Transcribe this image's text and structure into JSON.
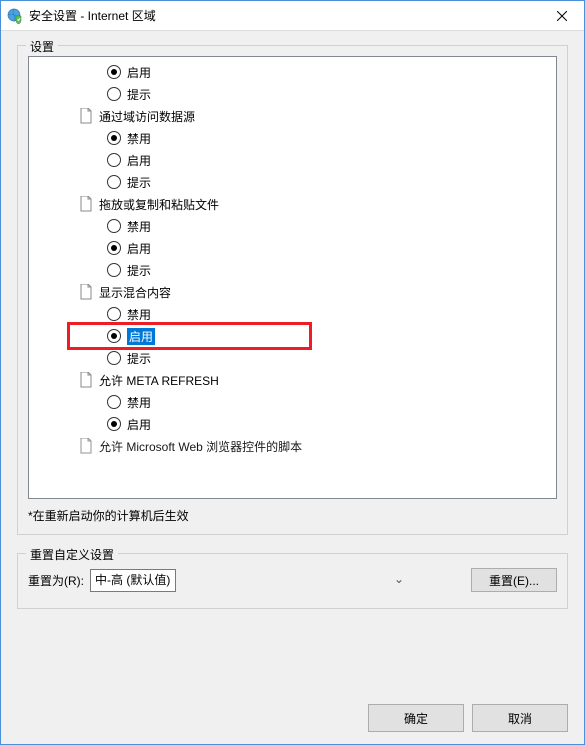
{
  "titlebar": {
    "title": "安全设置 - Internet 区域"
  },
  "settings": {
    "legend": "设置",
    "groups": [
      {
        "options": [
          {
            "label": "启用",
            "checked": true
          },
          {
            "label": "提示",
            "checked": false
          }
        ]
      },
      {
        "title": "通过域访问数据源",
        "options": [
          {
            "label": "禁用",
            "checked": true
          },
          {
            "label": "启用",
            "checked": false
          },
          {
            "label": "提示",
            "checked": false
          }
        ]
      },
      {
        "title": "拖放或复制和粘贴文件",
        "options": [
          {
            "label": "禁用",
            "checked": false
          },
          {
            "label": "启用",
            "checked": true
          },
          {
            "label": "提示",
            "checked": false
          }
        ]
      },
      {
        "title": "显示混合内容",
        "options": [
          {
            "label": "禁用",
            "checked": false
          },
          {
            "label": "启用",
            "checked": true,
            "selected": true,
            "highlighted": true
          },
          {
            "label": "提示",
            "checked": false
          }
        ]
      },
      {
        "title": "允许 META REFRESH",
        "options": [
          {
            "label": "禁用",
            "checked": false
          },
          {
            "label": "启用",
            "checked": true
          }
        ]
      },
      {
        "title_partial": "允许 Microsoft Web 浏览器控件的脚本"
      }
    ],
    "note": "*在重新启动你的计算机后生效"
  },
  "reset": {
    "legend": "重置自定义设置",
    "label": "重置为(R):",
    "selected": "中-高 (默认值)",
    "button": "重置(E)..."
  },
  "footer": {
    "ok": "确定",
    "cancel": "取消"
  }
}
